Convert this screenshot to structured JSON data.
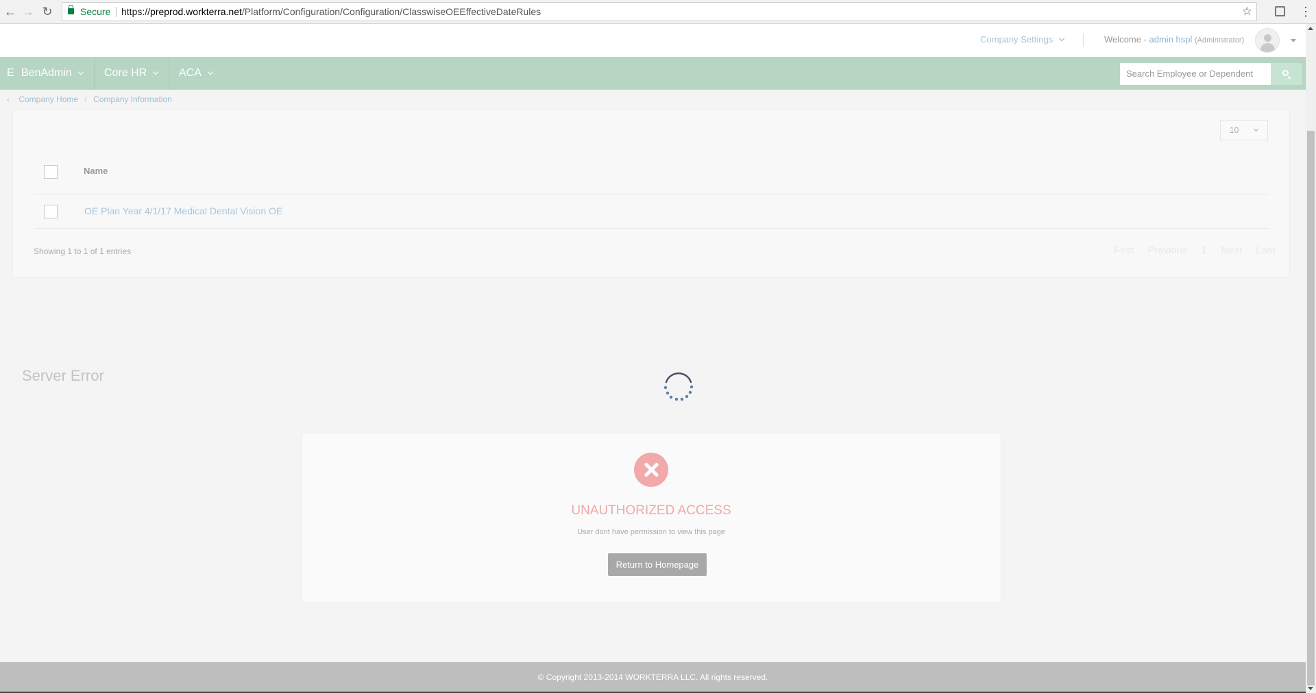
{
  "browser": {
    "secure_label": "Secure",
    "url_scheme": "https://",
    "url_host": "preprod.workterra.net",
    "url_path": "/Platform/Configuration/Configuration/ClasswiseOEEffectiveDateRules"
  },
  "header": {
    "company_settings": "Company Settings",
    "welcome_prefix": "Welcome -",
    "user_name": "admin hspl",
    "user_role": "(Administrator)"
  },
  "nav": {
    "cut_item": "E",
    "items": [
      {
        "label": "BenAdmin"
      },
      {
        "label": "Core HR"
      },
      {
        "label": "ACA"
      }
    ],
    "search_placeholder": "Search Employee or Dependent"
  },
  "breadcrumb": {
    "items": [
      "Company Home",
      "Company Information"
    ],
    "separator": "/"
  },
  "table": {
    "page_size": "10",
    "columns": [
      "Name"
    ],
    "rows": [
      {
        "name": "OE Plan Year 4/1/17 Medical Dental Vision OE"
      }
    ],
    "showing": "Showing 1 to 1 of 1 entries",
    "pager": [
      "First",
      "Previous",
      "1",
      "Next",
      "Last"
    ]
  },
  "error": {
    "heading": "Server Error",
    "title": "UNAUTHORIZED ACCESS",
    "message": "User dont have permission to view this page",
    "button": "Return to Homepage",
    "icon": "error-x-icon",
    "color": "#f1a9a9"
  },
  "footer": {
    "copyright": "© Copyright 2013-2014 WORKTERRA LLC. All rights reserved."
  },
  "colors": {
    "nav_bg": "#b6d6c3",
    "link": "#9dc0d6",
    "error": "#f1a7a7"
  }
}
